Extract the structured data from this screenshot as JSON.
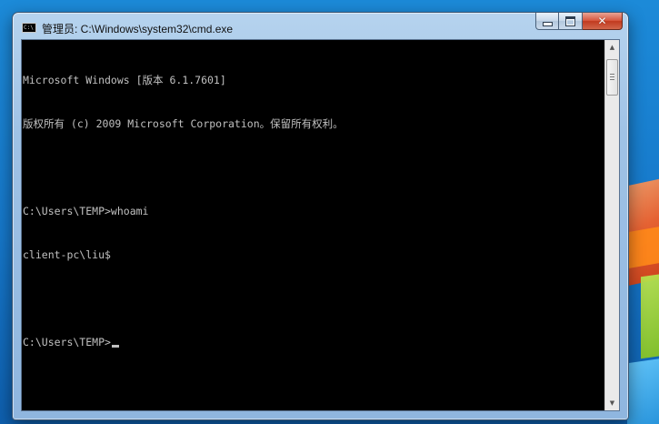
{
  "window": {
    "title": "管理员: C:\\Windows\\system32\\cmd.exe",
    "icon_label": "C:\\",
    "buttons": {
      "minimize": "minimize-icon",
      "maximize": "maximize-icon",
      "close_label": "✕"
    }
  },
  "console": {
    "lines": [
      "Microsoft Windows [版本 6.1.7601]",
      "版权所有 (c) 2009 Microsoft Corporation。保留所有权利。",
      "",
      "C:\\Users\\TEMP>whoami",
      "client-pc\\liu$",
      "",
      "C:\\Users\\TEMP>"
    ],
    "colors": {
      "background": "#000000",
      "foreground": "#c0c0c0"
    }
  },
  "scrollbar": {
    "up_arrow": "▲",
    "down_arrow": "▼"
  }
}
